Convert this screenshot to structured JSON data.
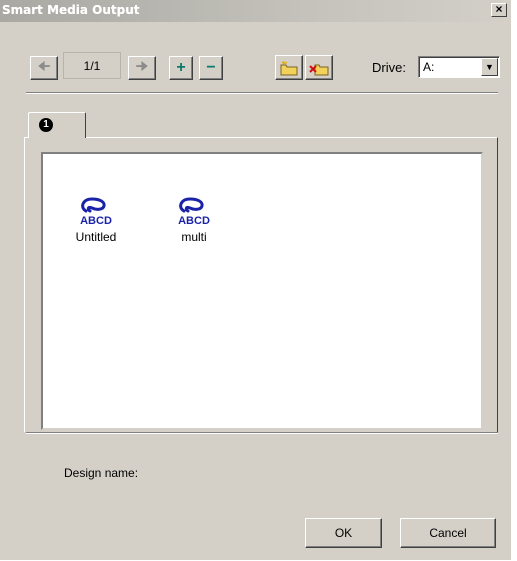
{
  "window": {
    "title": "Smart Media Output",
    "close_glyph": "×"
  },
  "toolbar": {
    "prev_icon": "arrow-left-icon",
    "next_icon": "arrow-right-icon",
    "page_indicator": "1/1",
    "add_label": "+",
    "remove_label": "−",
    "new_folder_icon": "folder-new-icon",
    "delete_folder_icon": "folder-delete-icon"
  },
  "drive": {
    "label": "Drive:",
    "value": "A:",
    "arrow": "▼"
  },
  "tabs": [
    {
      "label": "1"
    }
  ],
  "designs": [
    {
      "name": "Untitled",
      "icon": "embroidery-design-icon",
      "icon_text": "ABCD"
    },
    {
      "name": "multi",
      "icon": "embroidery-design-icon",
      "icon_text": "ABCD"
    }
  ],
  "footer": {
    "design_name_label": "Design name:",
    "design_name_value": ""
  },
  "buttons": {
    "ok": "OK",
    "cancel": "Cancel"
  },
  "colors": {
    "icon_blue": "#1a23a8",
    "accent_teal": "#0a7a6a",
    "dialog_face": "#d4d0c8"
  }
}
